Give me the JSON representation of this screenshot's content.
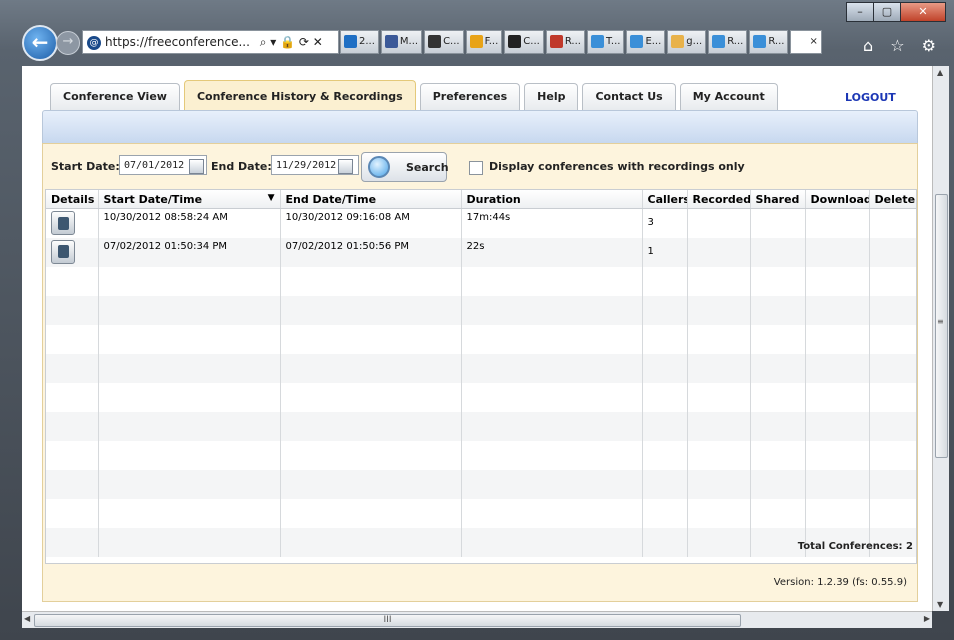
{
  "browser": {
    "address": "https://freeconference...",
    "address_tools": "⌕ ▾ 🔒 ⟳ ✕",
    "tabs": [
      "2...",
      "M...",
      "C...",
      "F...",
      "C...",
      "R...",
      "T...",
      "E...",
      "g...",
      "R...",
      "R...",
      "×"
    ],
    "tab_icon_colors": [
      "#1f6fc4",
      "#3b5998",
      "#333333",
      "#e8a317",
      "#222222",
      "#c0392b",
      "#3a8fd8",
      "#3a8fd8",
      "#e8b24a",
      "#3a8fd8",
      "#3a8fd8",
      "#ffffff"
    ],
    "right_icons": "⌂ ☆ ⚙"
  },
  "app": {
    "tabs": [
      {
        "label": "Conference View"
      },
      {
        "label": "Conference History & Recordings"
      },
      {
        "label": "Preferences"
      },
      {
        "label": "Help"
      },
      {
        "label": "Contact Us"
      },
      {
        "label": "My Account"
      }
    ],
    "active_tab": "Conference History & Recordings",
    "logout": "LOGOUT"
  },
  "filters": {
    "start_label": "Start Date:",
    "start_value": "07/01/2012",
    "end_label": "End Date:",
    "end_value": "11/29/2012",
    "search_label": "Search",
    "recordings_only_label": "Display conferences with recordings only",
    "recordings_only_checked": false
  },
  "table": {
    "columns": [
      "Details",
      "Start Date/Time",
      "End Date/Time",
      "Duration",
      "Callers",
      "Recorded",
      "Shared",
      "Download",
      "Delete"
    ],
    "rows": [
      {
        "start": "10/30/2012 08:58:24 AM",
        "end": "10/30/2012 09:16:08 AM",
        "duration": "17m:44s",
        "callers": "3",
        "recorded": "",
        "shared": "",
        "download": "",
        "delete": ""
      },
      {
        "start": "07/02/2012 01:50:34 PM",
        "end": "07/02/2012 01:50:56 PM",
        "duration": "22s",
        "callers": "1",
        "recorded": "",
        "shared": "",
        "download": "",
        "delete": ""
      }
    ],
    "sort_indicator": "▼"
  },
  "footer": {
    "total": "Total Conferences: 2",
    "version": "Version: 1.2.39 (fs: 0.55.9)"
  },
  "scrollbar": {
    "h_thumb_label": "III",
    "v_thumb_label": "≡"
  },
  "window": {
    "min": "–",
    "max": "▢",
    "close": "✕"
  }
}
